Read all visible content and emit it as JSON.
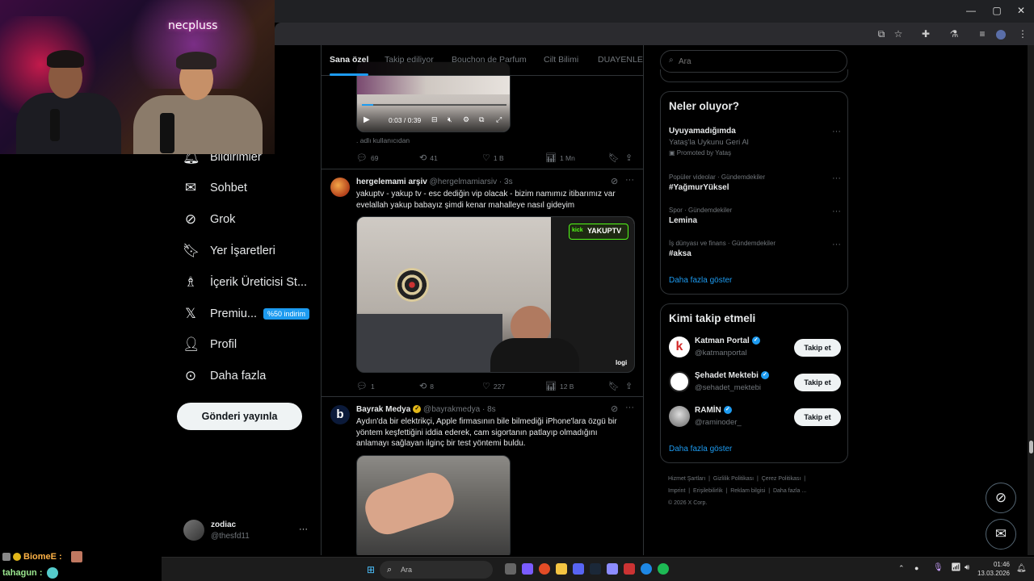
{
  "browser": {
    "window_controls": {
      "minimize": "—",
      "maximize": "▢",
      "close": "✕"
    },
    "toolbar_icons": [
      "cast-icon",
      "star-icon",
      "extensions-icon",
      "flask-icon",
      "queue-icon",
      "profile-icon",
      "menu-icon"
    ]
  },
  "webcam": {
    "logo": "necpluss"
  },
  "nav": {
    "items": [
      {
        "label": "Bildirimler",
        "icon": "bell-icon"
      },
      {
        "label": "Sohbet",
        "icon": "mail-icon"
      },
      {
        "label": "Grok",
        "icon": "grok-icon"
      },
      {
        "label": "Yer İşaretleri",
        "icon": "bookmark-icon"
      },
      {
        "label": "İçerik Üreticisi St...",
        "icon": "creator-icon"
      },
      {
        "label": "Premiu...",
        "icon": "x-logo-icon",
        "badge": "%50 indirim"
      },
      {
        "label": "Profil",
        "icon": "person-icon"
      },
      {
        "label": "Daha fazla",
        "icon": "more-circle-icon"
      }
    ],
    "post_button": "Gönderi yayınla",
    "account": {
      "name": "zodiac",
      "handle": "@thesfd11",
      "more": "···"
    }
  },
  "feed": {
    "tabs": [
      "Sana özel",
      "Takip ediliyor",
      "Bouchon de Parfum",
      "Cilt Bilimi",
      "DUAYENLER"
    ],
    "video_time": "0:03 / 0:39",
    "post0": {
      "footer_text": ". adlı kullanıcıdan",
      "replies": "69",
      "reposts": "41",
      "likes": "1 B",
      "views": "1 Mn"
    },
    "post1": {
      "name": "hergelemami arşiv",
      "handle": "@hergelmamiarsiv",
      "time": "· 3s",
      "text": "yakuptv - yakup tv - esc dediğin vip olacak - bizim namımız itibarımız var evelallah yakup babayız şimdi kenar mahalleye nasıl gideyim",
      "media_label": "kick",
      "media_brand": "YAKUPTV",
      "media_watermark": "logi",
      "replies": "1",
      "reposts": "8",
      "likes": "227",
      "views": "12 B"
    },
    "post2": {
      "name": "Bayrak Medya",
      "handle": "@bayrakmedya",
      "time": "· 8s",
      "text": "Aydın'da bir elektrikçi, Apple firmasının bile bilmediği iPhone'lara özgü bir yöntem keşfettiğini iddia ederek, cam sigortanın patlayıp olmadığını anlamayı sağlayan ilginç bir test yöntemi buldu.",
      "avatar_letter": "b"
    }
  },
  "right": {
    "search_placeholder": "Ara",
    "whats_happening": {
      "title": "Neler oluyor?",
      "trends": [
        {
          "title": "Uyuyamadığımda",
          "subtitle": "Yataş'la Uykunu Geri Al",
          "promoted": "Promoted by Yataş"
        },
        {
          "category": "Popüler videolar · Gündemdekiler",
          "title": "#YağmurYüksel"
        },
        {
          "category": "Spor · Gündemdekiler",
          "title": "Lemina"
        },
        {
          "category": "İş dünyası ve finans · Gündemdekiler",
          "title": "#aksa"
        }
      ],
      "show_more": "Daha fazla göster"
    },
    "who_to_follow": {
      "title": "Kimi takip etmeli",
      "users": [
        {
          "name": "Katman Portal",
          "handle": "@katmanportal"
        },
        {
          "name": "Şehadet Mektebi",
          "handle": "@sehadet_mektebi"
        },
        {
          "name": "RAMİN",
          "handle": "@raminoder_"
        }
      ],
      "follow_label": "Takip et",
      "show_more": "Daha fazla göster"
    },
    "footer": {
      "links": [
        "Hizmet Şartları",
        "Gizlilik Politikası",
        "Çerez Politikası",
        "Imprint",
        "Erişilebilirlik",
        "Reklam bilgisi",
        "Daha fazla ..."
      ],
      "copyright": "© 2026 X Corp."
    }
  },
  "chat": {
    "line1_user": "BiomeE :",
    "line2_user": "tahagun :"
  },
  "taskbar": {
    "search_label": "Ara",
    "time": "01:46",
    "date": "13.03.2026"
  },
  "colors": {
    "accent": "#1d9bf0",
    "text": "#e7e9ea",
    "muted": "#71767b",
    "border": "#2f3336"
  }
}
